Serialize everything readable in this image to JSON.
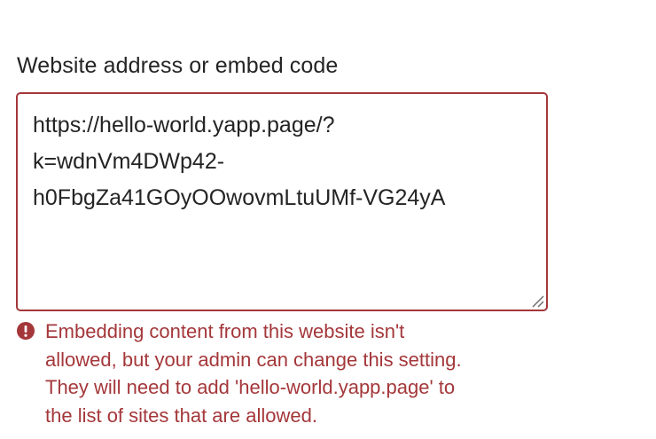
{
  "field": {
    "label": "Website address or embed code",
    "value": "https://hello-world.yapp.page/?\nk=wdnVm4DWp42-\nh0FbgZa41GOyOOwovmLtuUMf-VG24yA"
  },
  "error": {
    "icon": "exclamation-circle-icon",
    "message": "Embedding content from this website isn't\nallowed, but your admin can change this setting.\nThey will need to add 'hello-world.yapp.page' to\nthe list of sites that are allowed."
  },
  "colors": {
    "error": "#a4373a",
    "text": "#242424",
    "background": "#ffffff"
  }
}
